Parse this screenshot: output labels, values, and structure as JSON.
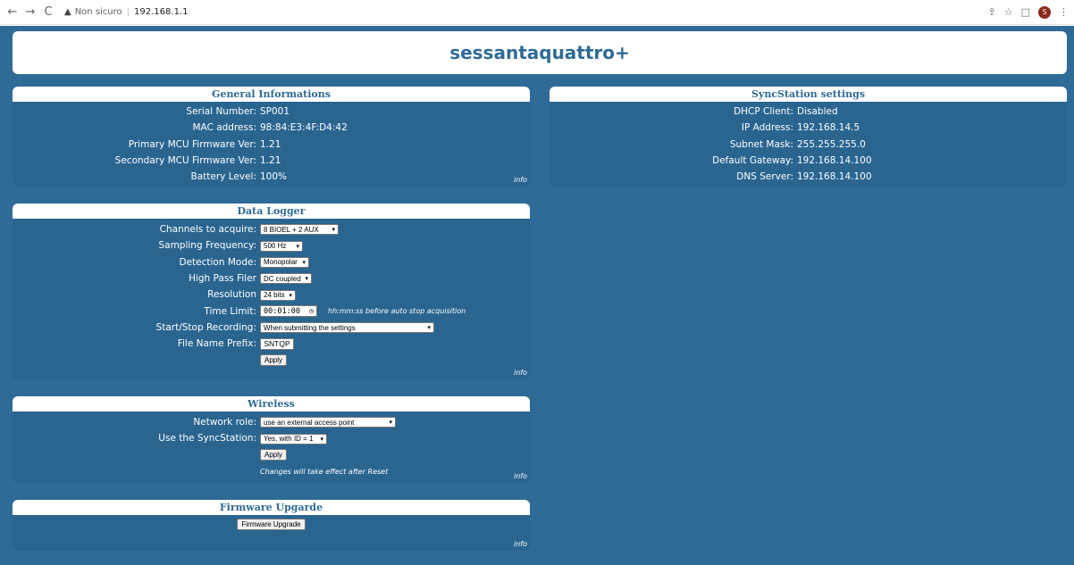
{
  "browser": {
    "security_label": "Non sicuro",
    "url": "192.168.1.1",
    "avatar_letter": "S"
  },
  "header": {
    "title": "sessantaquattro+"
  },
  "general": {
    "title": "General Informations",
    "rows": [
      {
        "label": "Serial Number:",
        "value": "SP001"
      },
      {
        "label": "MAC address:",
        "value": "98:84:E3:4F:D4:42"
      },
      {
        "label": "Primary MCU Firmware Ver:",
        "value": "1.21"
      },
      {
        "label": "Secondary MCU Firmware Ver:",
        "value": "1.21"
      },
      {
        "label": "Battery Level:",
        "value": "100%"
      }
    ],
    "info": "info"
  },
  "syncstation": {
    "title": "SyncStation settings",
    "rows": [
      {
        "label": "DHCP Client:",
        "value": "Disabled"
      },
      {
        "label": "IP Address:",
        "value": "192.168.14.5"
      },
      {
        "label": "Subnet Mask:",
        "value": "255.255.255.0"
      },
      {
        "label": "Default Gateway:",
        "value": "192.168.14.100"
      },
      {
        "label": "DNS Server:",
        "value": "192.168.14.100"
      }
    ]
  },
  "datalogger": {
    "title": "Data Logger",
    "channels_label": "Channels to acquire:",
    "channels_value": "8 BIOEL + 2 AUX",
    "sampling_label": "Sampling Frequency:",
    "sampling_value": "500 Hz",
    "detection_label": "Detection Mode:",
    "detection_value": "Monopolar",
    "hpf_label": "High Pass Filer",
    "hpf_value": "DC coupled",
    "resolution_label": "Resolution",
    "resolution_value": "24 bits",
    "timelimit_label": "Time Limit:",
    "timelimit_value": "00:01:00",
    "timelimit_hint": "hh:mm:ss before auto stop acquisition",
    "startstop_label": "Start/Stop Recording:",
    "startstop_value": "When submitting the settings",
    "prefix_label": "File Name Prefix:",
    "prefix_value": "SNTQP",
    "apply": "Apply",
    "info": "info"
  },
  "wireless": {
    "title": "Wireless",
    "role_label": "Network role:",
    "role_value": "use an external access point",
    "sync_label": "Use the SyncStation:",
    "sync_value": "Yes, with ID = 1",
    "apply": "Apply",
    "note": "Changes will take effect after Reset",
    "info": "info"
  },
  "firmware": {
    "title": "Firmware Upgarde",
    "button": "Firmware Upgrade",
    "info": "info"
  }
}
